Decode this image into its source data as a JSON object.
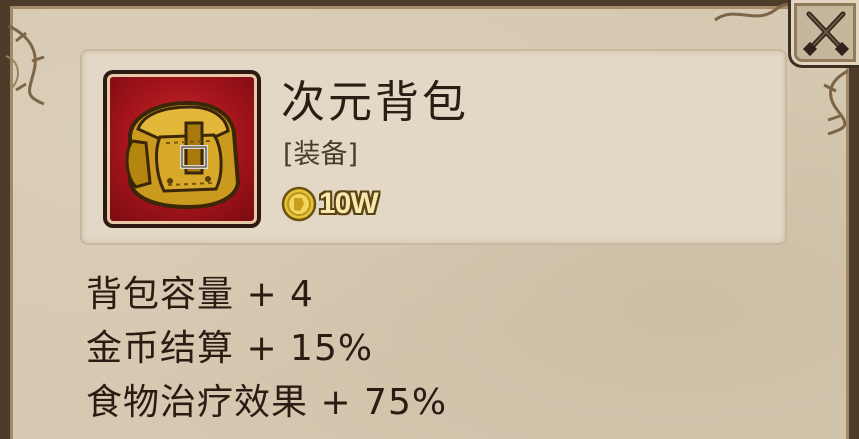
{
  "item": {
    "name": "次元背包",
    "type": "[装备]",
    "price": "10W",
    "icon": "backpack-icon"
  },
  "stats": [
    "背包容量 + 4",
    "金币结算 + 15%",
    "食物治疗效果 + 75%"
  ],
  "close_icon": "crossed-swords-close-icon",
  "colors": {
    "parchment": "#d6c9b1",
    "frame": "#4e3b2a",
    "icon_bg": "#a4141b",
    "coin": "#e5c23a"
  }
}
